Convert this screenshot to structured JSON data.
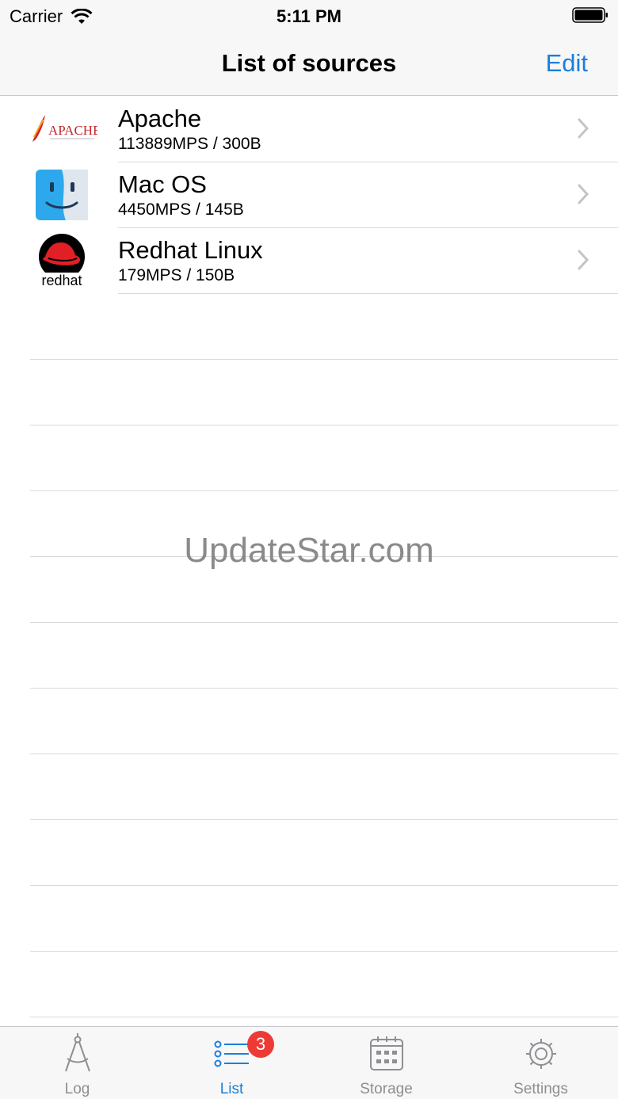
{
  "status_bar": {
    "carrier": "Carrier",
    "time": "5:11 PM"
  },
  "nav": {
    "title": "List of sources",
    "edit_label": "Edit"
  },
  "sources": [
    {
      "name": "Apache",
      "stats": "113889MPS / 300B",
      "icon": "apache-logo"
    },
    {
      "name": "Mac OS",
      "stats": "4450MPS / 145B",
      "icon": "macos-finder-logo"
    },
    {
      "name": "Redhat Linux",
      "stats": "179MPS / 150B",
      "icon": "redhat-logo"
    }
  ],
  "logos": {
    "apache_text": "APACHE",
    "redhat_text": "redhat"
  },
  "watermark": "UpdateStar.com",
  "tabs": [
    {
      "label": "Log",
      "icon": "compass-icon"
    },
    {
      "label": "List",
      "icon": "list-icon",
      "badge": "3"
    },
    {
      "label": "Storage",
      "icon": "calendar-icon"
    },
    {
      "label": "Settings",
      "icon": "gear-icon"
    }
  ],
  "colors": {
    "accent": "#1a7fdc",
    "badge": "#ee3a35"
  }
}
